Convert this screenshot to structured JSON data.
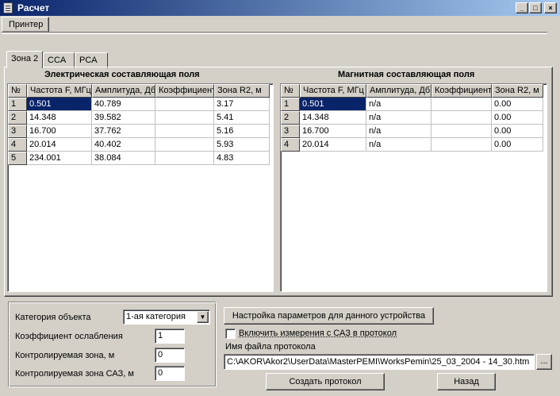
{
  "window": {
    "title": "Расчет",
    "controls": {
      "minimize": "_",
      "maximize": "□",
      "close": "×"
    }
  },
  "menu": {
    "printer_label": "Принтер"
  },
  "tabs": [
    {
      "label": "Зона 2",
      "active": true
    },
    {
      "label": "CCA",
      "active": false
    },
    {
      "label": "PCA",
      "active": false
    }
  ],
  "electric": {
    "title": "Электрическая составляющая поля",
    "headers": [
      "№",
      "Частота F, МГц",
      "Амплитуда, Дб",
      "Коэффициент",
      "Зона R2, м"
    ],
    "rows": [
      [
        "1",
        "0.501",
        "40.789",
        "",
        "3.17"
      ],
      [
        "2",
        "14.348",
        "39.582",
        "",
        "5.41"
      ],
      [
        "3",
        "16.700",
        "37.762",
        "",
        "5.16"
      ],
      [
        "4",
        "20.014",
        "40.402",
        "",
        "5.93"
      ],
      [
        "5",
        "234.001",
        "38.084",
        "",
        "4.83"
      ]
    ]
  },
  "magnetic": {
    "title": "Магнитная составляющая поля",
    "headers": [
      "№",
      "Частота F, МГц",
      "Амплитуда, Дб",
      "Коэффициент",
      "Зона R2, м"
    ],
    "rows": [
      [
        "1",
        "0.501",
        "n/a",
        "",
        "0.00"
      ],
      [
        "2",
        "14.348",
        "n/a",
        "",
        "0.00"
      ],
      [
        "3",
        "16.700",
        "n/a",
        "",
        "0.00"
      ],
      [
        "4",
        "20.014",
        "n/a",
        "",
        "0.00"
      ]
    ]
  },
  "settings": {
    "category_label": "Категория объекта",
    "category_value": "1-ая категория",
    "attenuation_label": "Коэффициент ослабления",
    "attenuation_value": "1",
    "zone_label": "Контролируемая зона, м",
    "zone_value": "0",
    "zone_saz_label": "Контролируемая зона САЗ, м",
    "zone_saz_value": "0"
  },
  "actions": {
    "device_settings_label": "Настройка параметров для данного устройства",
    "include_saz_label": "Включить измерения с САЗ в протокол",
    "include_saz_checked": false,
    "protocol_file_label": "Имя файла протокола",
    "protocol_file_value": "C:\\AKOR\\Akor2\\UserData\\MasterPEMI\\WorksPemin\\25_03_2004 - 14_30.htm",
    "browse_label": "...",
    "create_protocol_label": "Создать протокол",
    "back_label": "Назад"
  }
}
